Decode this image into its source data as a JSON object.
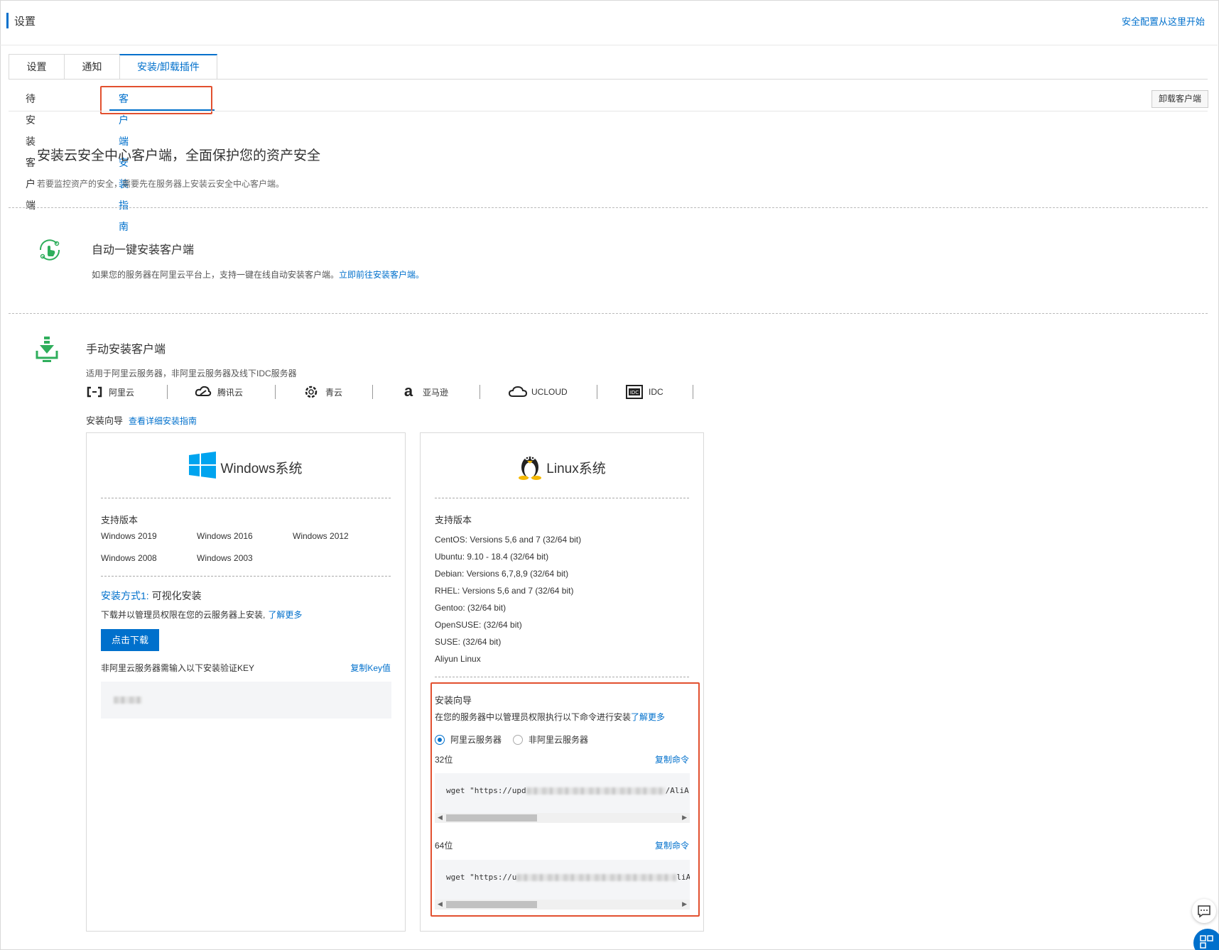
{
  "header": {
    "title": "设置",
    "right_link": "安全配置从这里开始"
  },
  "tabs": [
    {
      "label": "设置"
    },
    {
      "label": "通知"
    },
    {
      "label": "安装/卸载插件"
    }
  ],
  "subtabs": [
    {
      "label": "待安装客户端"
    },
    {
      "label": "客户端安装指南"
    }
  ],
  "uninstall_button": "卸载客户端",
  "intro": {
    "title": "安装云安全中心客户端，全面保护您的资产安全",
    "desc": "若要监控资产的安全，需要先在服务器上安装云安全中心客户端。"
  },
  "auto": {
    "title": "自动一键安装客户端",
    "desc": "如果您的服务器在阿里云平台上，支持一键在线自动安装客户端。",
    "link": "立即前往安装客户端。"
  },
  "manual": {
    "title": "手动安装客户端",
    "desc": "适用于阿里云服务器，非阿里云服务器及线下IDC服务器",
    "providers": [
      {
        "name": "阿里云",
        "icon": "aliyun-icon"
      },
      {
        "name": "腾讯云",
        "icon": "tencent-cloud-icon"
      },
      {
        "name": "青云",
        "icon": "qingcloud-icon"
      },
      {
        "name": "亚马逊",
        "icon": "amazon-icon"
      },
      {
        "name": "UCLOUD",
        "icon": "ucloud-icon"
      },
      {
        "name": "IDC",
        "icon": "idc-icon"
      }
    ],
    "guide_label": "安装向导",
    "guide_link": "查看详细安装指南"
  },
  "windows": {
    "name": "Windows系统",
    "support_label": "支持版本",
    "versions": [
      "Windows 2019",
      "Windows 2016",
      "Windows 2012",
      "Windows 2008",
      "Windows 2003"
    ],
    "method_prefix": "安装方式1:",
    "method_name": "可视化安装",
    "method_desc": "下载并以管理员权限在您的云服务器上安装,",
    "learn_more": "了解更多",
    "download_btn": "点击下载",
    "key_label": "非阿里云服务器需输入以下安装验证KEY",
    "copy_key": "复制Key值"
  },
  "linux": {
    "name": "Linux系统",
    "support_label": "支持版本",
    "versions": [
      "CentOS: Versions 5,6 and 7 (32/64 bit)",
      "Ubuntu: 9.10 - 18.4 (32/64 bit)",
      "Debian: Versions 6,7,8,9 (32/64 bit)",
      "RHEL: Versions 5,6 and 7 (32/64 bit)",
      "Gentoo: (32/64 bit)",
      "OpenSUSE: (32/64 bit)",
      "SUSE: (32/64 bit)",
      "Aliyun Linux"
    ],
    "guide_title": "安装向导",
    "guide_desc": "在您的服务器中以管理员权限执行以下命令进行安装",
    "learn_more": "了解更多",
    "radio_aliyun": "阿里云服务器",
    "radio_non_aliyun": "非阿里云服务器",
    "bit32_label": "32位",
    "bit64_label": "64位",
    "copy_cmd": "复制命令",
    "cmd32_prefix": "wget \"https://upd",
    "cmd32_suffix": "/AliA",
    "cmd64_prefix": "wget \"https://u",
    "cmd64_suffix": "liA"
  },
  "colors": {
    "accent": "#0070cc",
    "highlight": "#e2502f"
  }
}
